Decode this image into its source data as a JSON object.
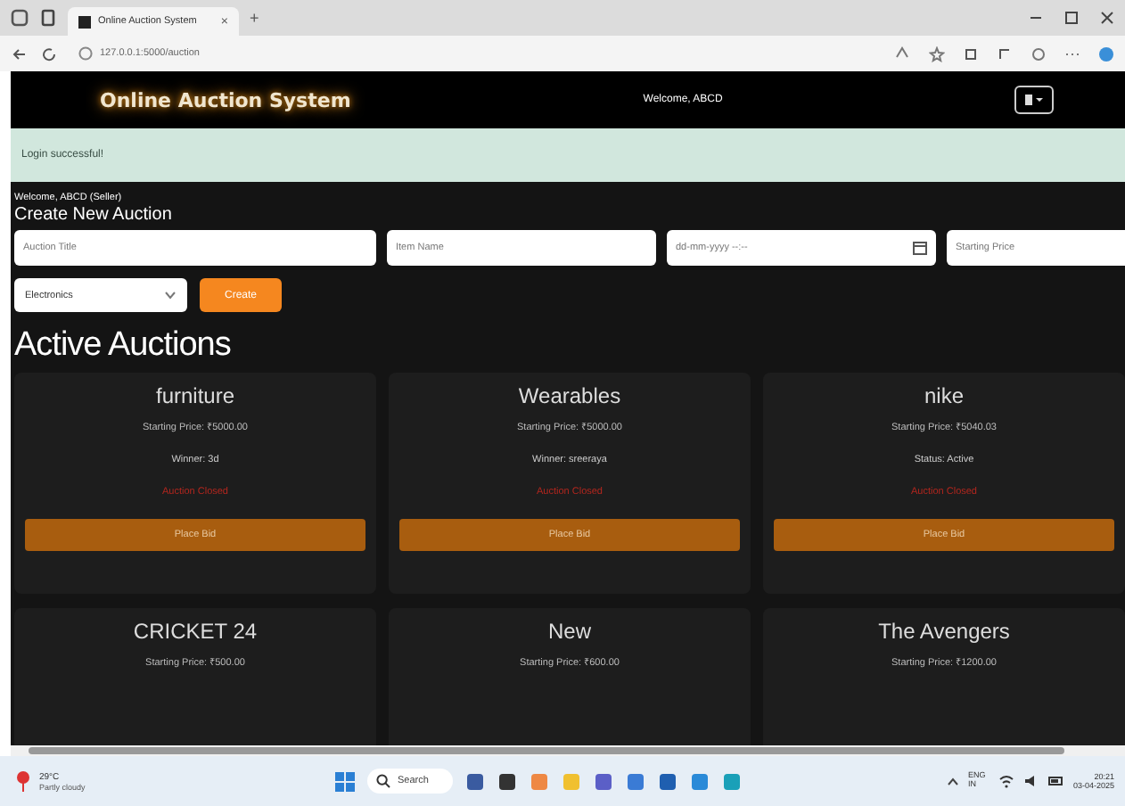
{
  "browser": {
    "tab_title": "Online Auction System",
    "tab_close": "×",
    "new_tab": "+",
    "url": "127.0.0.1:5000/auction"
  },
  "navbar": {
    "brand": "Online Auction System",
    "welcome": "Welcome, ABCD"
  },
  "alert": "Login successful!",
  "user_line": "Welcome, ABCD (Seller)",
  "form": {
    "heading": "Create New Auction",
    "fields": [
      {
        "placeholder": "Auction Title",
        "kind": "text"
      },
      {
        "placeholder": "Item Name",
        "kind": "text"
      },
      {
        "placeholder": "dd-mm-yyyy --:--",
        "kind": "date"
      },
      {
        "placeholder": "Starting Price",
        "kind": "text"
      }
    ],
    "category": "Electronics",
    "button": "Create"
  },
  "auctions_heading": "Active Auctions",
  "auctions": [
    {
      "title": "furniture",
      "price": "Starting Price: ₹5000.00",
      "info": "Winner: 3d",
      "status": "Auction Closed",
      "button": "Place Bid"
    },
    {
      "title": "Wearables",
      "price": "Starting Price: ₹5000.00",
      "info": "Winner: sreeraya",
      "status": "Auction Closed",
      "button": "Place Bid"
    },
    {
      "title": "nike",
      "price": "Starting Price: ₹5040.03",
      "info": "Status: Active",
      "status": "Auction Closed",
      "button": "Place Bid"
    },
    {
      "title": "CRICKET 24",
      "price": "Starting Price: ₹500.00"
    },
    {
      "title": "New",
      "price": "Starting Price: ₹600.00"
    },
    {
      "title": "The Avengers",
      "price": "Starting Price: ₹1200.00"
    }
  ],
  "taskbar": {
    "weather_temp": "29°C",
    "weather_text": "Partly cloudy",
    "search": "Search",
    "lang": "ENG IN",
    "time": "20:21",
    "date": "03-04-2025"
  }
}
